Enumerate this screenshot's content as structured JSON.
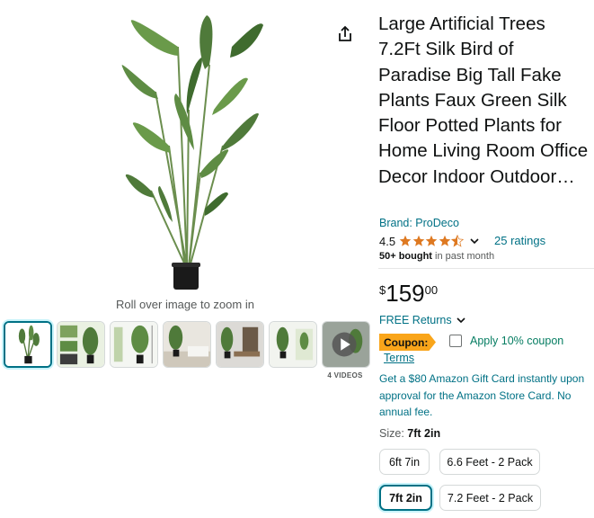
{
  "media": {
    "zoom_hint": "Roll over image to zoom in",
    "videos_label": "4 VIDEOS",
    "thumbnails": [
      {
        "name": "plant in black pot",
        "selected": true
      },
      {
        "name": "infographic features"
      },
      {
        "name": "size infographic"
      },
      {
        "name": "plant in living room"
      },
      {
        "name": "plant in office"
      },
      {
        "name": "two pack plants"
      },
      {
        "name": "video thumbnail"
      }
    ]
  },
  "product": {
    "title": "Large Artificial Trees 7.2Ft Silk Bird of Paradise Big Tall Fake Plants Faux Green Silk Floor Potted Plants for Home Living Room Office Decor Indoor Outdoor…",
    "brand": "Brand: ProDeco",
    "rating": "4.5",
    "ratings_count": "25 ratings",
    "bought_bold": "50+ bought",
    "bought_rest": " in past month",
    "price_symbol": "$",
    "price_whole": "159",
    "price_fraction": "00"
  },
  "offers": {
    "returns": "FREE Returns",
    "coupon_badge": "Coupon:",
    "coupon_text": "Apply 10% coupon",
    "terms": "Terms",
    "gift_card": "Get a $80 Amazon Gift Card instantly upon approval for the Amazon Store Card. No annual fee."
  },
  "size": {
    "label": "Size:",
    "selected": "7ft 2in",
    "options": [
      "6ft 7in",
      "6.6 Feet - 2 Pack",
      "7ft 2in",
      "7.2 Feet - 2 Pack"
    ]
  },
  "colors": {
    "link": "#007185",
    "coupon": "#f9a51a",
    "star": "#de7921",
    "green_text": "#067d62"
  }
}
